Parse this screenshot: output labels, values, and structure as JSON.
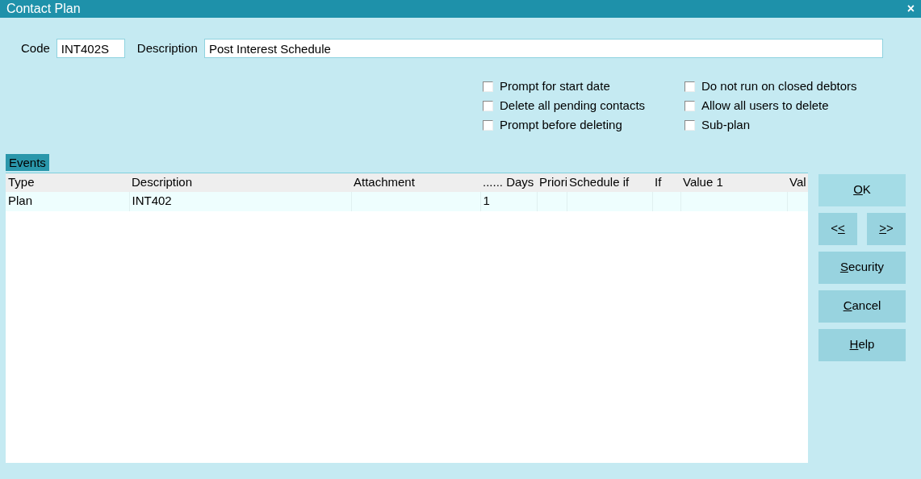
{
  "window": {
    "title": "Contact Plan",
    "close": "×"
  },
  "code": {
    "label": "Code",
    "value": "INT402S"
  },
  "description": {
    "label": "Description",
    "value": "Post Interest Schedule"
  },
  "options": [
    {
      "label": "Prompt for start date",
      "checked": false
    },
    {
      "label": "Delete all pending contacts",
      "checked": false
    },
    {
      "label": "Prompt before deleting",
      "checked": false
    },
    {
      "label": "Do not run on closed debtors",
      "checked": false
    },
    {
      "label": "Allow all users to delete",
      "checked": false
    },
    {
      "label": "Sub-plan",
      "checked": false
    }
  ],
  "events_tab": {
    "label": "Events",
    "selected": true
  },
  "table": {
    "columns": [
      "Type",
      "Description",
      "Attachment",
      "...... Days",
      "Priori",
      "Schedule if",
      "If",
      "Value 1",
      "Val"
    ],
    "rows": [
      {
        "selected": false,
        "cells": [
          "Plan",
          "INT402",
          null,
          "1",
          null,
          null,
          null,
          null,
          null
        ]
      }
    ]
  },
  "buttons": [
    {
      "key": "O",
      "after": "K",
      "default": true
    },
    {
      "before": "<",
      "key": "<",
      "default": false
    },
    {
      "key": ">",
      "after": ">",
      "default": false
    },
    {
      "key": "S",
      "after": "ecurity",
      "default": false
    },
    {
      "key": "C",
      "after": "ancel",
      "default": false
    },
    {
      "key": "H",
      "after": "elp",
      "default": false
    }
  ]
}
